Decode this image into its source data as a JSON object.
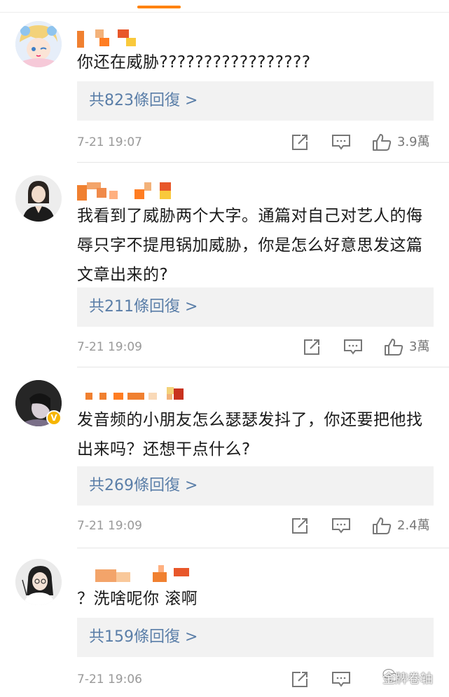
{
  "comments": [
    {
      "text": "你还在威胁?????????????????",
      "replies": "共823條回復 >",
      "time": "7-21 19:07",
      "likes": "3.9萬"
    },
    {
      "text": "我看到了威胁两个大字。通篇对自己对艺人的侮辱只字不提甩锅加威胁，你是怎么好意思发这篇文章出来的?",
      "replies": "共211條回復 >",
      "time": "7-21 19:09",
      "likes": "3萬"
    },
    {
      "text": "发音频的小朋友怎么瑟瑟发抖了，你还要把他找出来吗？还想干点什么?",
      "replies": "共269條回復 >",
      "time": "7-21 19:09",
      "likes": "2.4萬"
    },
    {
      "text": "？洗啥呢你 滚啊",
      "replies": "共159條回復 >",
      "time": "7-21 19:06",
      "likes": ""
    }
  ],
  "verified_badge": "V",
  "watermark": "金牌卷轴",
  "icons": [
    "share-icon",
    "comment-icon",
    "like-icon",
    "wechat-icon"
  ],
  "colors": {
    "accent": "#ff8200",
    "reply_link": "#5a7ea8",
    "reply_bg": "#f2f2f2",
    "meta_text": "#999999"
  }
}
